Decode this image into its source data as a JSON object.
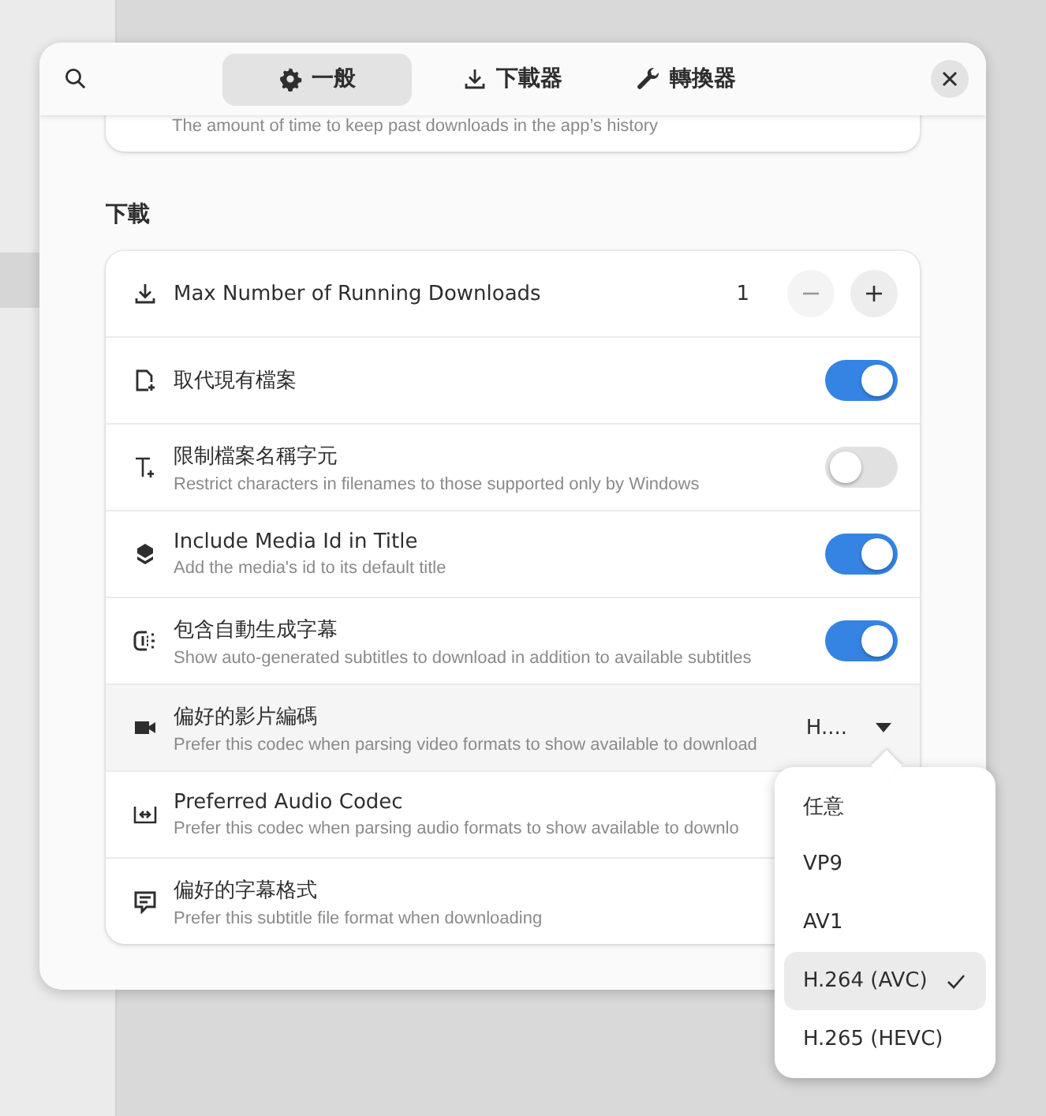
{
  "header": {
    "tabs": [
      {
        "label": "一般",
        "selected": true
      },
      {
        "label": "下載器",
        "selected": false
      },
      {
        "label": "轉換器",
        "selected": false
      }
    ]
  },
  "partial_row": {
    "subtitle": "The amount of time to keep past downloads in the app’s history"
  },
  "section": {
    "title": "下載",
    "rows": [
      {
        "kind": "stepper",
        "title": "Max Number of Running Downloads",
        "value": "1"
      },
      {
        "kind": "switch",
        "title": "取代現有檔案",
        "on": true
      },
      {
        "kind": "switch",
        "title": "限制檔案名稱字元",
        "subtitle": "Restrict characters in filenames to those supported only by Windows",
        "on": false
      },
      {
        "kind": "switch",
        "title": "Include Media Id in Title",
        "subtitle": "Add the media's id to its default title",
        "on": true
      },
      {
        "kind": "switch",
        "title": "包含自動生成字幕",
        "subtitle": "Show auto-generated subtitles to download in addition to available subtitles",
        "on": true
      },
      {
        "kind": "dropdown",
        "title": "偏好的影片編碼",
        "subtitle": "Prefer this codec when parsing video formats to show available to download",
        "value": "H....",
        "expanded": true
      },
      {
        "kind": "info",
        "title": "Preferred Audio Codec",
        "subtitle": "Prefer this codec when parsing audio formats to show available to downlo"
      },
      {
        "kind": "info",
        "title": "偏好的字幕格式",
        "subtitle": "Prefer this subtitle file format when downloading"
      }
    ]
  },
  "popover": {
    "items": [
      {
        "label": "任意",
        "selected": false
      },
      {
        "label": "VP9",
        "selected": false
      },
      {
        "label": "AV1",
        "selected": false
      },
      {
        "label": "H.264 (AVC)",
        "selected": true
      },
      {
        "label": "H.265 (HEVC)",
        "selected": false
      }
    ]
  }
}
